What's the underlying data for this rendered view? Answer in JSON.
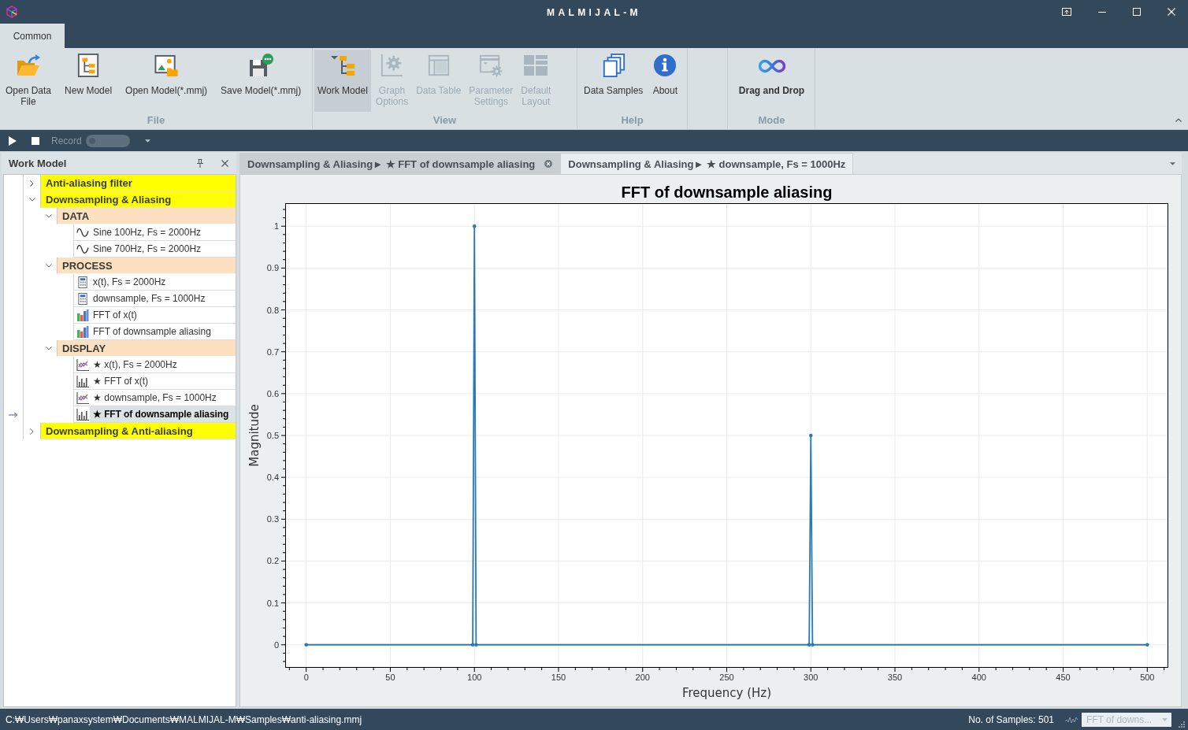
{
  "window": {
    "title": "MALMIJAL-M"
  },
  "ribbon_tabs": [
    {
      "label": "Common",
      "selected": true
    }
  ],
  "ribbon": {
    "groups": [
      {
        "label": "File",
        "buttons": [
          {
            "kind": "opendata",
            "label": "Open Data\nFile",
            "disabled": false,
            "pressed": false
          },
          {
            "kind": "newmodel",
            "label": "New Model",
            "disabled": false,
            "pressed": false
          },
          {
            "kind": "openmodel",
            "label": "Open Model(*.mmj)",
            "disabled": false,
            "pressed": false
          },
          {
            "kind": "savemodel",
            "label": "Save Model(*.mmj)",
            "disabled": false,
            "pressed": false
          }
        ]
      },
      {
        "label": "View",
        "buttons": [
          {
            "kind": "workmodel",
            "label": "Work Model",
            "disabled": false,
            "pressed": true
          },
          {
            "kind": "graphoptions",
            "label": "Graph\nOptions",
            "disabled": true,
            "pressed": false
          },
          {
            "kind": "datatable",
            "label": "Data Table",
            "disabled": true,
            "pressed": false
          },
          {
            "kind": "parameters",
            "label": "Parameter\nSettings",
            "disabled": true,
            "pressed": false
          },
          {
            "kind": "layout",
            "label": "Default\nLayout",
            "disabled": true,
            "pressed": false
          }
        ]
      },
      {
        "label": "Help",
        "buttons": [
          {
            "kind": "samples",
            "label": "Data Samples",
            "disabled": false,
            "pressed": false
          },
          {
            "kind": "about",
            "label": "About",
            "disabled": false,
            "pressed": false
          }
        ]
      },
      {
        "label": "Mode",
        "buttons": [
          {
            "kind": "dragdrop",
            "label": "Drag and Drop",
            "disabled": false,
            "pressed": false,
            "active": true
          }
        ]
      }
    ]
  },
  "toolbar": {
    "record": {
      "label": "Record",
      "on": false
    }
  },
  "work_model_panel": {
    "title": "Work Model",
    "items": [
      {
        "kind": "model",
        "label": "Anti-aliasing filter",
        "expanded": false,
        "selected": false
      },
      {
        "kind": "model",
        "label": "Downsampling & Aliasing",
        "expanded": true,
        "selected": false,
        "children": [
          {
            "kind": "category",
            "label": "DATA",
            "expanded": true,
            "selected": false,
            "children": [
              {
                "kind": "sine",
                "label": "Sine 100Hz, Fs = 2000Hz",
                "selected": false
              },
              {
                "kind": "sine",
                "label": "Sine 700Hz, Fs = 2000Hz",
                "selected": false
              }
            ]
          },
          {
            "kind": "category",
            "label": "PROCESS",
            "expanded": true,
            "selected": false,
            "children": [
              {
                "kind": "calc",
                "label": "x(t), Fs = 2000Hz",
                "selected": false
              },
              {
                "kind": "calc",
                "label": "downsample, Fs = 1000Hz",
                "selected": false
              },
              {
                "kind": "fft",
                "label": "FFT of x(t)",
                "selected": false
              },
              {
                "kind": "fft",
                "label": "FFT of downsample aliasing",
                "selected": false
              }
            ]
          },
          {
            "kind": "category",
            "label": "DISPLAY",
            "expanded": true,
            "selected": false,
            "children": [
              {
                "kind": "lineplot",
                "label": "★ x(t), Fs = 2000Hz",
                "selected": false
              },
              {
                "kind": "barplot",
                "label": "★ FFT of x(t)",
                "selected": false
              },
              {
                "kind": "lineplot",
                "label": "★ downsample, Fs = 1000Hz",
                "selected": false
              },
              {
                "kind": "barplot",
                "label": "★ FFT of downsample aliasing",
                "selected": true
              }
            ]
          }
        ]
      },
      {
        "kind": "model",
        "label": "Downsampling & Anti-aliasing",
        "expanded": false,
        "selected": false
      }
    ]
  },
  "document_tabs": [
    {
      "label": "Downsampling & Aliasing► ★ FFT of downsample aliasing",
      "selected": true
    },
    {
      "label": "Downsampling & Aliasing► ★ downsample, Fs = 1000Hz",
      "selected": false
    }
  ],
  "chart_data": {
    "type": "line",
    "title": "FFT of downsample aliasing",
    "xlabel": "Frequency (Hz)",
    "ylabel": "Magnitude",
    "x": [
      0,
      99,
      100,
      101,
      299,
      300,
      301,
      500
    ],
    "series": [
      {
        "color": "#2a7ab8",
        "values": [
          0,
          0,
          1,
          0,
          0,
          0.5,
          0,
          0
        ]
      }
    ],
    "xlim": [
      -12.5,
      512.5
    ],
    "ylim": [
      -0.055,
      1.055
    ],
    "xticks": [
      0,
      50,
      100,
      150,
      200,
      250,
      300,
      350,
      400,
      450,
      500
    ],
    "yticks": [
      0,
      0.1,
      0.2,
      0.3,
      0.4,
      0.5,
      0.6,
      0.7,
      0.8,
      0.9,
      1
    ],
    "grid": true
  },
  "status_bar": {
    "path": "C:₩Users₩panaxsystem₩Documents₩MALMIJAL-M₩Samples₩anti-aliasing.mmj",
    "samples": "No. of Samples: 501",
    "graph_select": {
      "value": "FFT of downs...",
      "disabled": true
    }
  }
}
